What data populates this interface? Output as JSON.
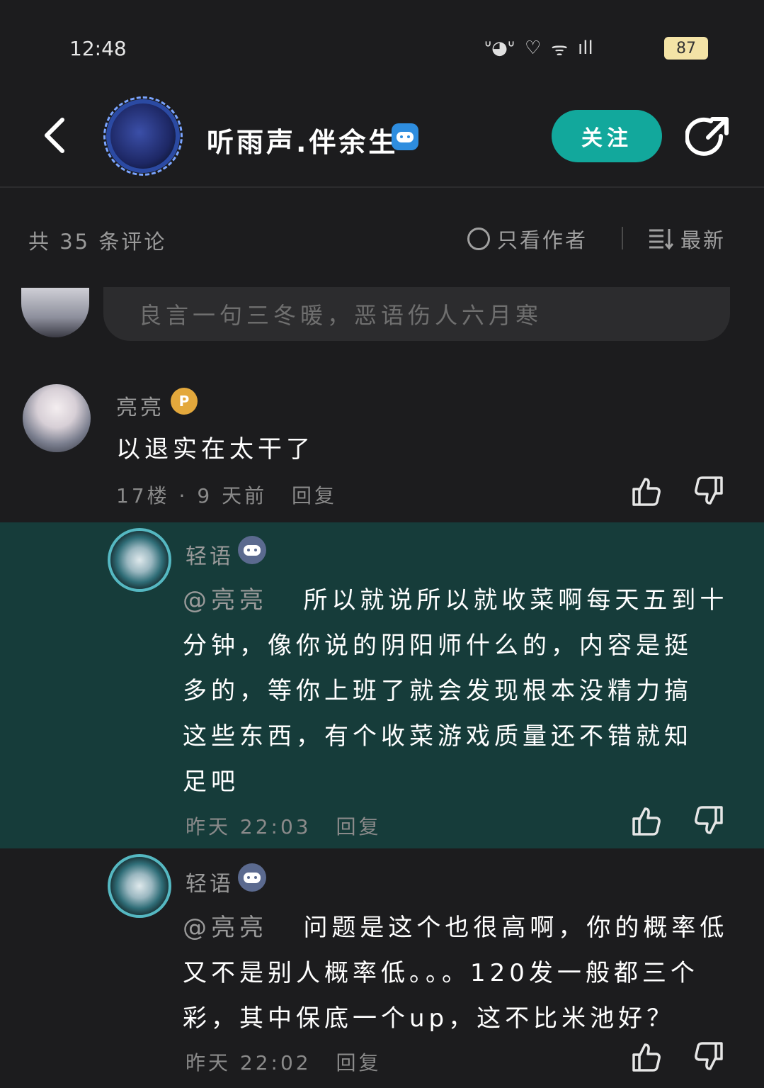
{
  "status_bar": {
    "time": "12:48",
    "battery": "87",
    "icons": [
      "notification-icon",
      "heart-icon",
      "wifi-icon",
      "signal-icon"
    ]
  },
  "header": {
    "author_name": "听雨声.伴余生",
    "follow_label": "关注"
  },
  "filter_bar": {
    "comment_count": "共 35 条评论",
    "author_only": "只看作者",
    "sort": "最新"
  },
  "reply_input": {
    "placeholder": "良言一句三冬暖，恶语伤人六月寒"
  },
  "comments": [
    {
      "user": "亮亮",
      "text": "以退实在太干了",
      "floor": "17楼",
      "time": "9 天前",
      "reply_label": "回复"
    }
  ],
  "replies": [
    {
      "user": "轻语",
      "mention": "@亮亮",
      "text_lines": [
        "所以就说所以就收菜啊每天五到十",
        "分钟，像你说的阴阳师什么的，内容是挺",
        "多的，等你上班了就会发现根本没精力搞",
        "这些东西，有个收菜游戏质量还不错就知",
        "足吧"
      ],
      "time": "昨天 22:03",
      "reply_label": "回复"
    },
    {
      "user": "轻语",
      "mention": "@亮亮",
      "text_lines": [
        "问题是这个也很高啊，你的概率低",
        "又不是别人概率低。。。120发一般都三个",
        "彩，其中保底一个up，这不比米池好？"
      ],
      "time": "昨天 22:02",
      "reply_label": "回复"
    }
  ],
  "colors": {
    "background": "#1c1c1e",
    "follow_button": "#12a89c",
    "highlight_row": "#163c3a",
    "verified_badge": "#2e8ddf"
  }
}
